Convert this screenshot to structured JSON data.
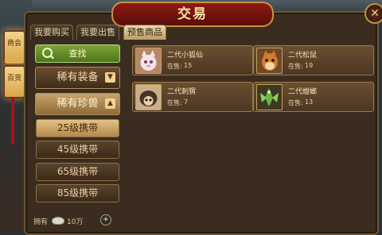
{
  "window": {
    "title": "交易",
    "close": "✕"
  },
  "lanterns": [
    "商会",
    "百货"
  ],
  "tabs": [
    {
      "label": "我要购买",
      "active": false
    },
    {
      "label": "我要出售",
      "active": false
    },
    {
      "label": "预售商品",
      "active": true
    }
  ],
  "sidebar": {
    "search_label": "查找",
    "categories": [
      {
        "label": "稀有装备",
        "arrow": "▼"
      },
      {
        "label": "稀有珍兽",
        "arrow": "▲"
      }
    ],
    "subcategories": [
      "25级携带",
      "45级携带",
      "65级携带",
      "85级携带"
    ],
    "active_subcategory": "25级携带"
  },
  "items": [
    {
      "name": "二代小狐仙",
      "stock_label": "在售:",
      "stock": "15"
    },
    {
      "name": "二代松鼠",
      "stock_label": "在售:",
      "stock": "19"
    },
    {
      "name": "二代刺猬",
      "stock_label": "在售:",
      "stock": "7"
    },
    {
      "name": "二代螳螂",
      "stock_label": "在售:",
      "stock": "13"
    }
  ],
  "footer": {
    "owned_label": "拥有",
    "money": "10万",
    "add": "+"
  }
}
